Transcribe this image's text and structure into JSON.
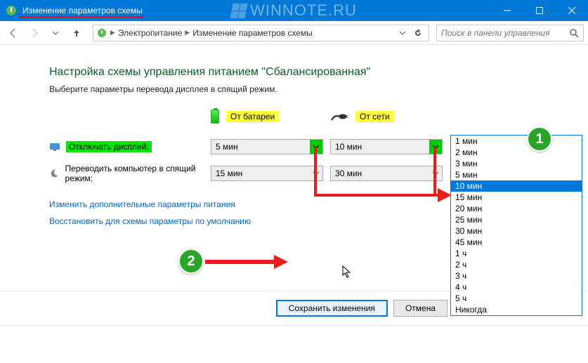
{
  "titlebar": {
    "title": "Изменение параметров схемы",
    "watermark": "WINNOTE.RU"
  },
  "nav": {
    "crumb1": "Электропитание",
    "crumb2": "Изменение параметров схемы",
    "search_placeholder": "Поиск в панели управления"
  },
  "heading": "Настройка схемы управления питанием \"Сбалансированная\"",
  "subtext": "Выберите параметры перевода дисплея в спящий режим.",
  "cols": {
    "battery": "От батареи",
    "ac": "От сети"
  },
  "rows": {
    "display_off": {
      "label": "Отключать дисплей:",
      "battery_value": "5 мин",
      "ac_value": "10 мин"
    },
    "sleep": {
      "label": "Переводить компьютер в спящий режим:",
      "battery_value": "15 мин",
      "ac_value": "30 мин"
    }
  },
  "links": {
    "advanced": "Изменить дополнительные параметры питания",
    "restore": "Восстановить для схемы параметры по умолчанию"
  },
  "buttons": {
    "save": "Сохранить изменения",
    "cancel": "Отмена"
  },
  "dropdown_options": [
    "1 мин",
    "2 мин",
    "3 мин",
    "5 мин",
    "10 мин",
    "15 мин",
    "20 мин",
    "25 мин",
    "30 мин",
    "45 мин",
    "1 ч",
    "2 ч",
    "3 ч",
    "4 ч",
    "5 ч",
    "Никогда"
  ],
  "dropdown_selected": "10 мин",
  "badges": {
    "one": "1",
    "two": "2"
  }
}
